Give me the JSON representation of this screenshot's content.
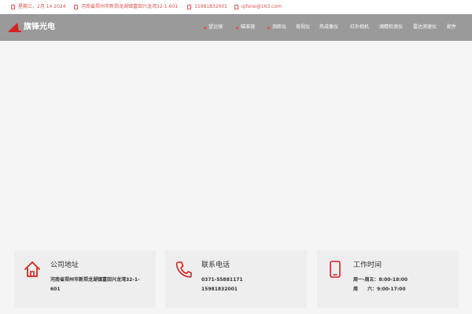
{
  "topbar": {
    "date": "星期三，2月 14 2024",
    "address": "河南省郑州市新郑龙湖镇富田兴龙湾32-1-601",
    "phone": "15981832001",
    "email": "qifone@163.com"
  },
  "header": {
    "logo_text": "旗锋光电",
    "nav": [
      "望远镜",
      "瞄准镜",
      "测距仪",
      "夜视仪",
      "热成像仪",
      "红外相机",
      "酒精检测仪",
      "雷达测速仪",
      "配件"
    ]
  },
  "cards": [
    {
      "title": "公司地址",
      "icon": "home-icon",
      "lines": [
        "河南省郑州市新郑龙湖镇富田兴龙湾32-1-",
        "601"
      ]
    },
    {
      "title": "联系电话",
      "icon": "phone-icon",
      "lines": [
        "0371-55881171",
        "15981832001"
      ]
    },
    {
      "title": "工作时间",
      "icon": "tablet-icon",
      "lines": [
        "周一-周五：8:00-18:00",
        "周　　六：9:00-17:00"
      ]
    }
  ],
  "colors": {
    "accent": "#d9211f",
    "header_bg": "#9a9a9a",
    "card_bg": "#eeeeee"
  }
}
